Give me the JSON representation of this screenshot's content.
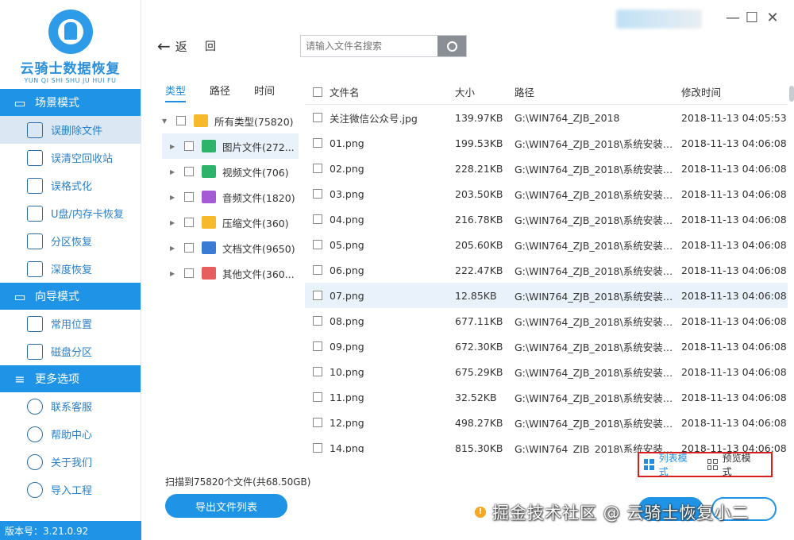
{
  "app": {
    "logo_title": "云骑士数据恢复",
    "logo_subtitle": "YUN QI SHI SHU JU HUI FU",
    "version": "版本号：3.21.0.92"
  },
  "sidebar": {
    "sections": [
      {
        "title": "场景模式",
        "icon": "scene-icon",
        "items": [
          {
            "label": "误删除文件",
            "icon": "delete-file-icon",
            "active": true
          },
          {
            "label": "误清空回收站",
            "icon": "recycle-bin-icon"
          },
          {
            "label": "误格式化",
            "icon": "format-icon"
          },
          {
            "label": "U盘/内存卡恢复",
            "icon": "usb-icon"
          },
          {
            "label": "分区恢复",
            "icon": "partition-icon"
          },
          {
            "label": "深度恢复",
            "icon": "deep-recovery-icon"
          }
        ]
      },
      {
        "title": "向导模式",
        "icon": "guide-icon",
        "items": [
          {
            "label": "常用位置",
            "icon": "location-icon"
          },
          {
            "label": "磁盘分区",
            "icon": "disk-icon"
          }
        ]
      },
      {
        "title": "更多选项",
        "icon": "menu-icon",
        "items": [
          {
            "label": "联系客服",
            "icon": "support-icon"
          },
          {
            "label": "帮助中心",
            "icon": "help-icon"
          },
          {
            "label": "关于我们",
            "icon": "about-icon"
          },
          {
            "label": "导入工程",
            "icon": "import-icon"
          }
        ]
      }
    ]
  },
  "toolbar": {
    "back_label": "返",
    "home_label": "回",
    "search_placeholder": "请输入文件名搜索"
  },
  "tree": {
    "tabs": [
      "类型",
      "路径",
      "时间"
    ],
    "active_tab": 0,
    "rows": [
      {
        "label": "所有类型(75820)",
        "expanded": true,
        "color": "#f6b92b",
        "icon": "folder-icon"
      },
      {
        "label": "图片文件(272...",
        "color": "#2db36a",
        "icon": "image-icon"
      },
      {
        "label": "视频文件(706)",
        "color": "#2db36a",
        "icon": "video-icon"
      },
      {
        "label": "音频文件(1820)",
        "color": "#a55ad6",
        "icon": "audio-icon"
      },
      {
        "label": "压缩文件(360)",
        "color": "#f6b92b",
        "icon": "archive-icon"
      },
      {
        "label": "文档文件(9650)",
        "color": "#3a7bd5",
        "icon": "document-icon"
      },
      {
        "label": "其他文件(360...",
        "color": "#e85d5d",
        "icon": "other-icon"
      }
    ]
  },
  "list": {
    "columns": [
      "文件名",
      "大小",
      "路径",
      "修改时间"
    ],
    "rows": [
      {
        "name": "关注微信公众号.jpg",
        "size": "139.97KB",
        "path": "G:\\WIN764_ZJB_2018",
        "time": "2018-11-13 04:05:53"
      },
      {
        "name": "01.png",
        "size": "199.53KB",
        "path": "G:\\WIN764_ZJB_2018\\系统安装-...",
        "time": "2018-11-13 04:06:08"
      },
      {
        "name": "02.png",
        "size": "228.21KB",
        "path": "G:\\WIN764_ZJB_2018\\系统安装-...",
        "time": "2018-11-13 04:06:08"
      },
      {
        "name": "03.png",
        "size": "203.50KB",
        "path": "G:\\WIN764_ZJB_2018\\系统安装-...",
        "time": "2018-11-13 04:06:08"
      },
      {
        "name": "04.png",
        "size": "216.78KB",
        "path": "G:\\WIN764_ZJB_2018\\系统安装-...",
        "time": "2018-11-13 04:06:08"
      },
      {
        "name": "05.png",
        "size": "205.60KB",
        "path": "G:\\WIN764_ZJB_2018\\系统安装-...",
        "time": "2018-11-13 04:06:08"
      },
      {
        "name": "06.png",
        "size": "222.47KB",
        "path": "G:\\WIN764_ZJB_2018\\系统安装-...",
        "time": "2018-11-13 04:06:08"
      },
      {
        "name": "07.png",
        "size": "12.85KB",
        "path": "G:\\WIN764_ZJB_2018\\系统安装-...",
        "time": "2018-11-13 04:06:08",
        "selected": true
      },
      {
        "name": "08.png",
        "size": "677.11KB",
        "path": "G:\\WIN764_ZJB_2018\\系统安装-...",
        "time": "2018-11-13 04:06:08"
      },
      {
        "name": "09.png",
        "size": "672.30KB",
        "path": "G:\\WIN764_ZJB_2018\\系统安装-...",
        "time": "2018-11-13 04:06:08"
      },
      {
        "name": "10.png",
        "size": "675.29KB",
        "path": "G:\\WIN764_ZJB_2018\\系统安装-...",
        "time": "2018-11-13 04:06:08"
      },
      {
        "name": "11.png",
        "size": "32.52KB",
        "path": "G:\\WIN764_ZJB_2018\\系统安装-...",
        "time": "2018-11-13 04:06:08"
      },
      {
        "name": "12.png",
        "size": "498.27KB",
        "path": "G:\\WIN764_ZJB_2018\\系统安装-...",
        "time": "2018-11-13 04:06:08"
      },
      {
        "name": "14.png",
        "size": "815.30KB",
        "path": "G:\\WIN764_ZJB_2018\\系统安装-...",
        "time": "2018-11-13 04:06:08"
      }
    ]
  },
  "bottom": {
    "scan_info": "扫描到75820个文件(共68.50GB)",
    "export_label": "导出文件列表",
    "list_mode_label": "列表模式",
    "preview_mode_label": "预览模式",
    "watermark": "掘金技术社区 @ 云骑士恢复小二"
  },
  "colors": {
    "accent": "#1f94e6",
    "highlight_box": "#d81e1e",
    "selected_row": "#e9f2fa"
  }
}
